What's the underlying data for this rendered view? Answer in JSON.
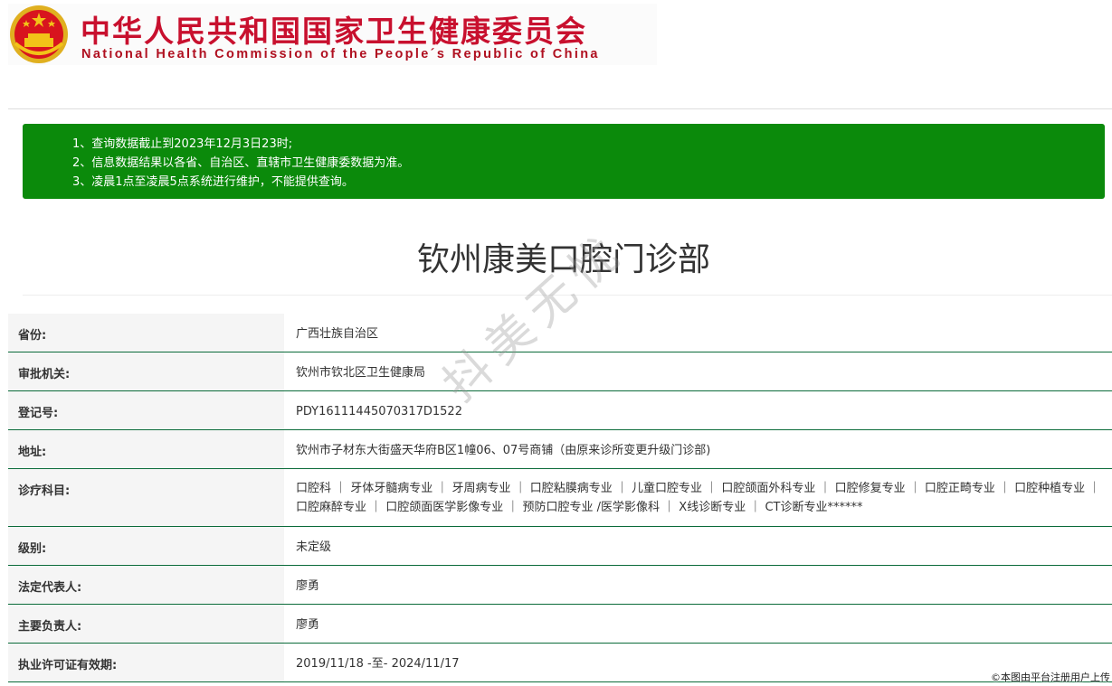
{
  "header": {
    "title_cn": "中华人民共和国国家卫生健康委员会",
    "title_en": "National Health Commission of the People´s Republic of China"
  },
  "notice": {
    "lines": [
      "1、查询数据截止到2023年12月3日23时;",
      "2、信息数据结果以各省、自治区、直辖市卫生健康委数据为准。",
      "3、凌晨1点至凌晨5点系统进行维护，不能提供查询。"
    ]
  },
  "page_title": "钦州康美口腔门诊部",
  "rows": [
    {
      "label": "省份:",
      "value": "广西壮族自治区"
    },
    {
      "label": "审批机关:",
      "value": "钦州市钦北区卫生健康局"
    },
    {
      "label": "登记号:",
      "value": "PDY16111445070317D1522"
    },
    {
      "label": "地址:",
      "value": "钦州市子材东大街盛天华府B区1幢06、07号商铺（由原来诊所变更升级门诊部)"
    },
    {
      "label": "诊疗科目:",
      "value": "口腔科 ｜ 牙体牙髓病专业 ｜ 牙周病专业 ｜ 口腔粘膜病专业 ｜ 儿童口腔专业 ｜ 口腔颌面外科专业 ｜ 口腔修复专业 ｜ 口腔正畸专业 ｜ 口腔种植专业 ｜ 口腔麻醉专业 ｜ 口腔颌面医学影像专业 ｜ 预防口腔专业 /医学影像科 ｜ X线诊断专业 ｜ CT诊断专业******"
    },
    {
      "label": "级别:",
      "value": "未定级"
    },
    {
      "label": "法定代表人:",
      "value": "廖勇"
    },
    {
      "label": "主要负责人:",
      "value": "廖勇"
    },
    {
      "label": "执业许可证有效期:",
      "value": "2019/11/18 -至- 2024/11/17"
    }
  ],
  "watermark": "抖美无忧",
  "footer_note": "©本图由平台注册用户上传",
  "colors": {
    "brand_red": "#c8102e",
    "notice_green": "#0b8a0b",
    "row_border": "#0b6b3a"
  }
}
